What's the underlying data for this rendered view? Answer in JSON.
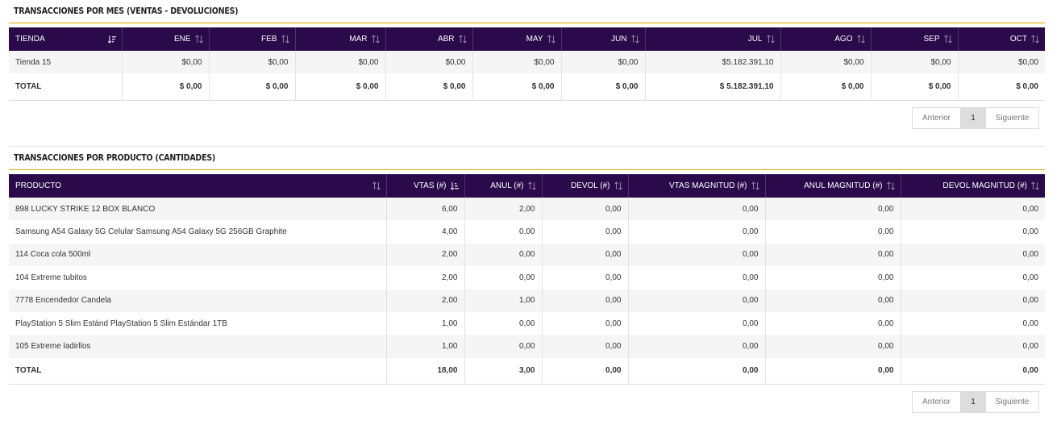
{
  "section1": {
    "title": "TRANSACCIONES POR MES (VENTAS - DEVOLUCIONES)",
    "columns": [
      "TIENDA",
      "ENE",
      "FEB",
      "MAR",
      "ABR",
      "MAY",
      "JUN",
      "JUL",
      "AGO",
      "SEP",
      "OCT"
    ],
    "rows": [
      [
        "Tienda 15",
        "$0,00",
        "$0,00",
        "$0,00",
        "$0,00",
        "$0,00",
        "$0,00",
        "$5.182.391,10",
        "$0,00",
        "$0,00",
        "$0,00"
      ]
    ],
    "total": [
      "TOTAL",
      "$ 0,00",
      "$ 0,00",
      "$ 0,00",
      "$ 0,00",
      "$ 0,00",
      "$ 0,00",
      "$ 5.182.391,10",
      "$ 0,00",
      "$ 0,00",
      "$ 0,00"
    ],
    "pagination": {
      "prev": "Anterior",
      "page": "1",
      "next": "Siguiente"
    }
  },
  "section2": {
    "title": "TRANSACCIONES POR PRODUCTO (CANTIDADES)",
    "columns": [
      "PRODUCTO",
      "VTAS (#)",
      "ANUL (#)",
      "DEVOL (#)",
      "VTAS MAGNITUD (#)",
      "ANUL MAGNITUD (#)",
      "DEVOL MAGNITUD (#)"
    ],
    "rows": [
      [
        "898 LUCKY STRIKE 12 BOX BLANCO",
        "6,00",
        "2,00",
        "0,00",
        "0,00",
        "0,00",
        "0,00"
      ],
      [
        "Samsung A54 Galaxy 5G Celular Samsung A54 Galaxy 5G 256GB Graphite",
        "4,00",
        "0,00",
        "0,00",
        "0,00",
        "0,00",
        "0,00"
      ],
      [
        "114 Coca cola 500ml",
        "2,00",
        "0,00",
        "0,00",
        "0,00",
        "0,00",
        "0,00"
      ],
      [
        "104 Extreme tubitos",
        "2,00",
        "0,00",
        "0,00",
        "0,00",
        "0,00",
        "0,00"
      ],
      [
        "7778 Encendedor Candela",
        "2,00",
        "1,00",
        "0,00",
        "0,00",
        "0,00",
        "0,00"
      ],
      [
        "PlayStation 5 Slim Estánd PlayStation 5 Slim Estándar 1TB",
        "1,00",
        "0,00",
        "0,00",
        "0,00",
        "0,00",
        "0,00"
      ],
      [
        "105 Extreme ladirllos",
        "1,00",
        "0,00",
        "0,00",
        "0,00",
        "0,00",
        "0,00"
      ]
    ],
    "total": [
      "TOTAL",
      "18,00",
      "3,00",
      "0,00",
      "0,00",
      "0,00",
      "0,00"
    ],
    "pagination": {
      "prev": "Anterior",
      "page": "1",
      "next": "Siguiente"
    }
  },
  "icons": {
    "sort": "sort-both-icon",
    "sort_asc": "sort-ascending-icon",
    "sort_desc": "sort-descending-icon"
  },
  "colors": {
    "header_bg": "#2a0a4a",
    "accent_rule": "#e0a800"
  }
}
